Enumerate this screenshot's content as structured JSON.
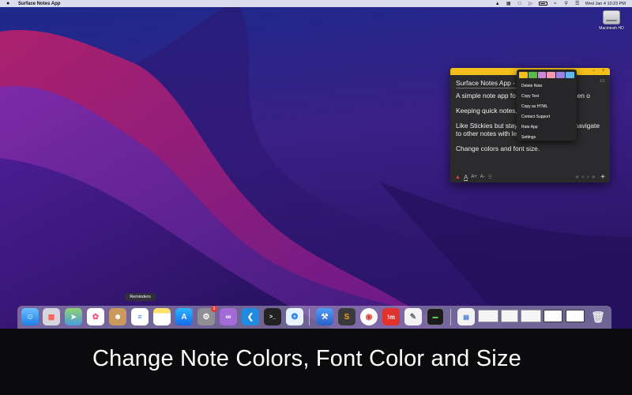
{
  "menubar": {
    "app_name": "Surface Notes App",
    "datetime": "Wed Jan 4  10:23 PM"
  },
  "desktop": {
    "disk_label": "Macintosh HD"
  },
  "note": {
    "title": "Surface Notes App - ...",
    "page_indicator": "1/1",
    "paragraphs": [
      "A simple note app fo                    ing research and when o",
      "Keeping quick notes,                        at hand.",
      "Like Stickies but stay                  dows and you can navigate to other notes with left-right arrows.",
      "Change colors and font size."
    ],
    "footer": {
      "font_color_label": "A",
      "font_larger_label": "A+",
      "font_smaller_label": "A-",
      "first_label": "«",
      "prev_label": "‹",
      "next_label": "›",
      "last_label": "»",
      "add_label": "+"
    }
  },
  "context_menu": {
    "swatch_colors": [
      "#f4bf1b",
      "#58b949",
      "#c98ad8",
      "#f29ab2",
      "#9b82e0",
      "#5fb8e8"
    ],
    "items": [
      "Delete Note",
      "Copy Text",
      "Copy as HTML",
      "Contact Support",
      "Rate App",
      "Settings"
    ]
  },
  "tooltip": "Reminders",
  "dock": {
    "badge_count": "1"
  },
  "caption": "Change Note Colors, Font Color and Size",
  "colors": {
    "note_yellow": "#f4bf1b",
    "note_bg": "#2b2b2d",
    "caption_bg": "#0b0b0d"
  }
}
